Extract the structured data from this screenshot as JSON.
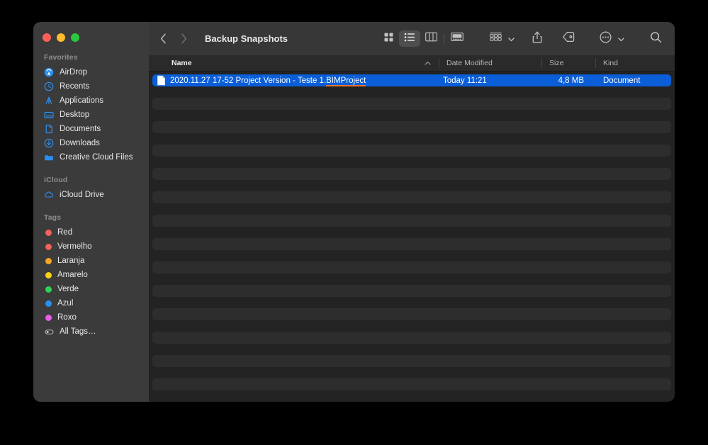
{
  "window": {
    "title": "Backup Snapshots",
    "traffic_lights": [
      {
        "name": "close",
        "color": "#ff5f57"
      },
      {
        "name": "minimize",
        "color": "#febc2e"
      },
      {
        "name": "maximize",
        "color": "#28c840"
      }
    ]
  },
  "toolbar": {
    "back_icon": "chevron-left-icon",
    "forward_icon": "chevron-right-icon",
    "view_modes": [
      {
        "name": "icon-view",
        "icon": "grid-icon",
        "active": false
      },
      {
        "name": "list-view",
        "icon": "list-icon",
        "active": true
      },
      {
        "name": "column-view",
        "icon": "columns-icon",
        "active": false
      },
      {
        "name": "gallery-view",
        "icon": "gallery-icon",
        "active": false
      }
    ],
    "group_icon": "group-by-icon",
    "share_icon": "share-icon",
    "tag_icon": "tag-icon",
    "more_icon": "ellipsis-circle-icon",
    "search_icon": "search-icon",
    "chevron_icon": "chevron-down-icon"
  },
  "sidebar": {
    "sections": [
      {
        "label": "Favorites",
        "items": [
          {
            "label": "AirDrop",
            "icon": "airdrop-icon"
          },
          {
            "label": "Recents",
            "icon": "clock-icon"
          },
          {
            "label": "Applications",
            "icon": "applications-icon"
          },
          {
            "label": "Desktop",
            "icon": "desktop-icon"
          },
          {
            "label": "Documents",
            "icon": "document-icon"
          },
          {
            "label": "Downloads",
            "icon": "download-icon"
          },
          {
            "label": "Creative Cloud Files",
            "icon": "folder-icon"
          }
        ]
      },
      {
        "label": "iCloud",
        "items": [
          {
            "label": "iCloud Drive",
            "icon": "cloud-icon"
          }
        ]
      },
      {
        "label": "Tags",
        "items": [
          {
            "label": "Red",
            "icon": "tag-dot",
            "color": "#f2615c"
          },
          {
            "label": "Vermelho",
            "icon": "tag-dot",
            "color": "#f2615c"
          },
          {
            "label": "Laranja",
            "icon": "tag-dot",
            "color": "#f5a623"
          },
          {
            "label": "Amarelo",
            "icon": "tag-dot",
            "color": "#f7d117"
          },
          {
            "label": "Verde",
            "icon": "tag-dot",
            "color": "#30d158"
          },
          {
            "label": "Azul",
            "icon": "tag-dot",
            "color": "#2a8ff0"
          },
          {
            "label": "Roxo",
            "icon": "tag-dot",
            "color": "#e85ce8"
          },
          {
            "label": "All Tags…",
            "icon": "all-tags-icon"
          }
        ]
      }
    ]
  },
  "file_list": {
    "columns": [
      {
        "key": "name",
        "label": "Name",
        "sorted": "asc"
      },
      {
        "key": "date",
        "label": "Date Modified"
      },
      {
        "key": "size",
        "label": "Size"
      },
      {
        "key": "kind",
        "label": "Kind"
      }
    ],
    "rows": [
      {
        "name": "2020.11.27 17-52 Project Version - Teste 1.",
        "name_extension": "BIMProject",
        "date": "Today 11:21",
        "size": "4,8 MB",
        "kind": "Document",
        "selected": true,
        "icon": "document-icon",
        "extension_underline_color": "#e8762c"
      }
    ],
    "empty_row_count": 13,
    "selection_color": "#0a5ed7",
    "stripe_color": "#2d2d2d"
  }
}
